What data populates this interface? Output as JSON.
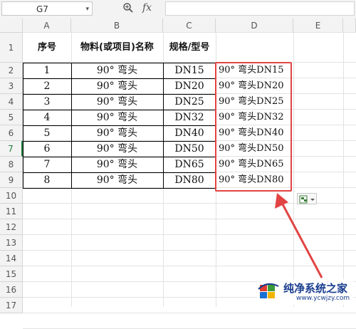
{
  "name_box": {
    "value": "G7"
  },
  "formula_bar": {
    "fx_label": "fx",
    "value": ""
  },
  "columns": [
    "A",
    "B",
    "C",
    "D",
    "E"
  ],
  "rows": [
    "1",
    "2",
    "3",
    "4",
    "5",
    "6",
    "7",
    "8",
    "9",
    "10",
    "11",
    "12",
    "13",
    "14",
    "15",
    "16",
    "17"
  ],
  "selected_row": "7",
  "table": {
    "headers": [
      "序号",
      "物料(或项目)名称",
      "规格/型号",
      ""
    ],
    "rows": [
      [
        "1",
        "90° 弯头",
        "DN15",
        "90° 弯头DN15"
      ],
      [
        "2",
        "90° 弯头",
        "DN20",
        "90° 弯头DN20"
      ],
      [
        "3",
        "90° 弯头",
        "DN25",
        "90° 弯头DN25"
      ],
      [
        "4",
        "90° 弯头",
        "DN32",
        "90° 弯头DN32"
      ],
      [
        "5",
        "90° 弯头",
        "DN40",
        "90° 弯头DN40"
      ],
      [
        "6",
        "90° 弯头",
        "DN50",
        "90° 弯头DN50"
      ],
      [
        "7",
        "90° 弯头",
        "DN65",
        "90° 弯头DN65"
      ],
      [
        "8",
        "90° 弯头",
        "DN80",
        "90° 弯头DN80"
      ]
    ]
  },
  "watermark": {
    "title": "纯净系统之家",
    "url": "www.ycwjzy.com"
  },
  "colors": {
    "highlight": "#e24444",
    "selected_row": "#1e7e3e",
    "watermark": "#1a3d8f"
  },
  "icons": {
    "zoom": "magnifier-icon",
    "paste_options": "paste-options-icon"
  }
}
